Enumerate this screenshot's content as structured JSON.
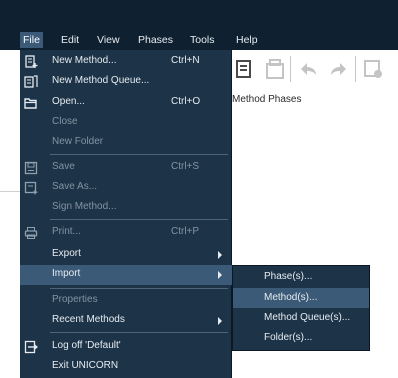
{
  "menubar": {
    "items": [
      "File",
      "Edit",
      "View",
      "Phases",
      "Tools",
      "Help"
    ]
  },
  "canvas": {
    "tab_label": "Method Phases"
  },
  "file_menu": {
    "items": [
      {
        "label": "New Method...",
        "shortcut": "Ctrl+N",
        "icon": "new-method-icon",
        "enabled": true
      },
      {
        "label": "New Method Queue...",
        "shortcut": "",
        "icon": "new-method-queue-icon",
        "enabled": true
      },
      {
        "label": "Open...",
        "shortcut": "Ctrl+O",
        "icon": "open-folder-icon",
        "enabled": true
      },
      {
        "label": "Close",
        "shortcut": "",
        "icon": "",
        "enabled": false
      },
      {
        "label": "New Folder",
        "shortcut": "",
        "icon": "",
        "enabled": false
      },
      {
        "label": "Save",
        "shortcut": "Ctrl+S",
        "icon": "save-icon",
        "enabled": false
      },
      {
        "label": "Save As...",
        "shortcut": "",
        "icon": "save-as-icon",
        "enabled": false
      },
      {
        "label": "Sign Method...",
        "shortcut": "",
        "icon": "",
        "enabled": false
      },
      {
        "label": "Print...",
        "shortcut": "Ctrl+P",
        "icon": "print-icon",
        "enabled": false
      },
      {
        "label": "Export",
        "shortcut": "",
        "icon": "",
        "enabled": true,
        "submenu": true
      },
      {
        "label": "Import",
        "shortcut": "",
        "icon": "",
        "enabled": true,
        "submenu": true,
        "highlighted": true
      },
      {
        "label": "Properties",
        "shortcut": "",
        "icon": "",
        "enabled": false
      },
      {
        "label": "Recent Methods",
        "shortcut": "",
        "icon": "",
        "enabled": true,
        "submenu": true
      },
      {
        "label": "Log off 'Default'",
        "shortcut": "",
        "icon": "log-off-icon",
        "enabled": true
      },
      {
        "label": "Exit UNICORN",
        "shortcut": "",
        "icon": "",
        "enabled": true
      }
    ]
  },
  "import_submenu": {
    "items": [
      {
        "label": "Phase(s)..."
      },
      {
        "label": "Method(s)...",
        "highlighted": true
      },
      {
        "label": "Method Queue(s)..."
      },
      {
        "label": "Folder(s)..."
      }
    ]
  },
  "colors": {
    "menubar_bg": "#0f2030",
    "menu_bg": "#1d3347",
    "highlight": "#3b5a78",
    "text": "#e6ecf1",
    "disabled_text": "#8394a3"
  }
}
